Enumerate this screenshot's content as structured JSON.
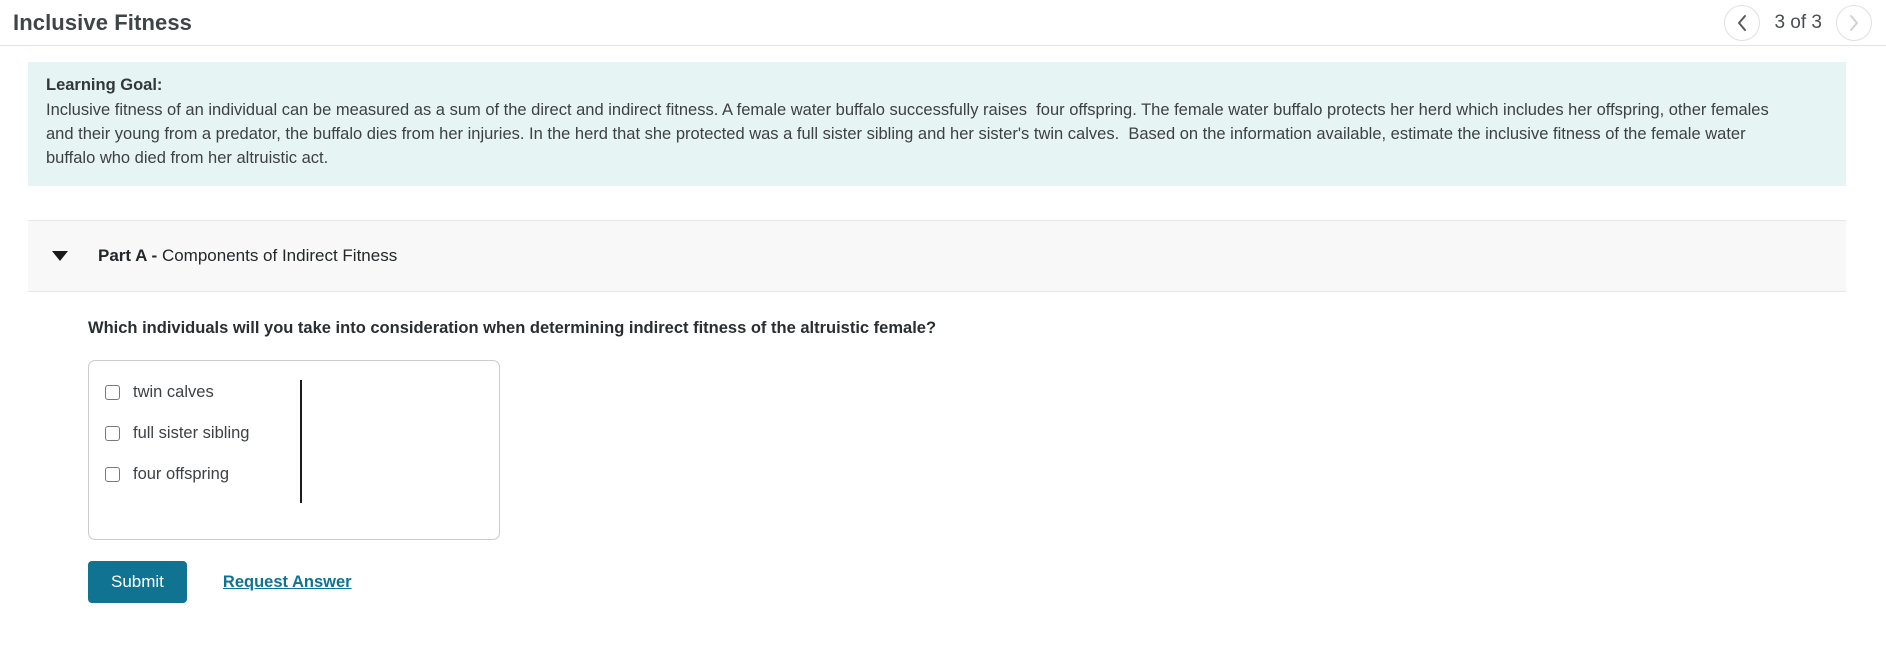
{
  "header": {
    "title": "Inclusive Fitness",
    "pager": {
      "prev_icon": "chevron-left-icon",
      "next_icon": "chevron-right-icon",
      "label": "3 of 3",
      "current": 3,
      "total": 3
    }
  },
  "learning_goal": {
    "title": "Learning Goal:",
    "body": "Inclusive fitness of an individual can be measured as a sum of the direct and indirect fitness. A female water buffalo successfully raises  four offspring. The female water buffalo protects her herd which includes her offspring, other females and their young from a predator, the buffalo dies from her injuries. In the herd that she protected was a full sister sibling and her sister's twin calves.  Based on the information available, estimate the inclusive fitness of the female water buffalo who died from her altruistic act.",
    "background_color": "#e6f4f3"
  },
  "part": {
    "caret_icon": "caret-down-icon",
    "name": "Part A -",
    "subtitle": "Components of Indirect Fitness",
    "expanded": true
  },
  "question": {
    "prompt": "Which individuals will you take into consideration when determining indirect fitness of the altruistic female?",
    "options": [
      {
        "label": "twin calves",
        "checked": false
      },
      {
        "label": "full sister sibling",
        "checked": false
      },
      {
        "label": "four offspring",
        "checked": false
      }
    ]
  },
  "actions": {
    "submit_label": "Submit",
    "request_answer_label": "Request Answer",
    "accent_color": "#0f7391"
  }
}
